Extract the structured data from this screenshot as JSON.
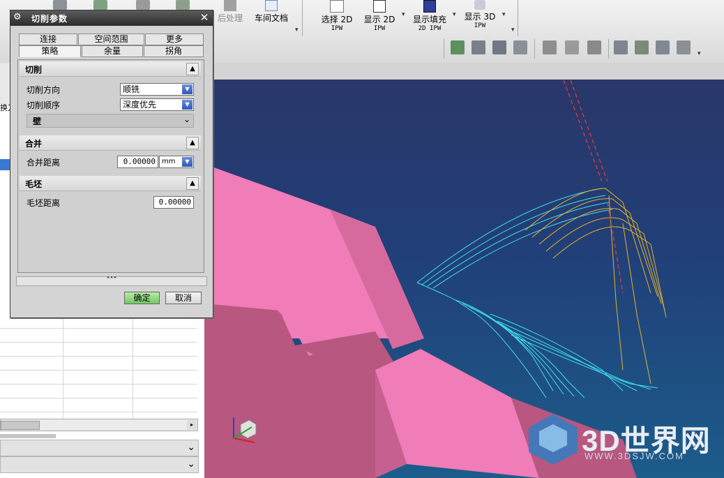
{
  "toolbar": {
    "postprocess_label": "后处理",
    "shop_doc_label": "车间文档",
    "select_2d": {
      "line1": "选择 2D",
      "line2": "IPW"
    },
    "show_2d": {
      "line1": "显示 2D",
      "line2": "IPW"
    },
    "show_fill": {
      "line1": "显示填充",
      "line2": "2D IPW"
    },
    "show_3d": {
      "line1": "显示 3D",
      "line2": "IPW"
    },
    "dropdown_glyph": "▾"
  },
  "left_panel": {
    "column_header": "换刀"
  },
  "dialog": {
    "title": "切削参数",
    "tabs_row1": [
      "连接",
      "空间范围",
      "更多"
    ],
    "tabs_row2": [
      "策略",
      "余量",
      "拐角"
    ],
    "active_tab": "策略",
    "sections": {
      "cutting": {
        "title": "切削",
        "direction_label": "切削方向",
        "direction_value": "顺铣",
        "order_label": "切削顺序",
        "order_value": "深度优先",
        "wall_label": "壁"
      },
      "merge": {
        "title": "合并",
        "distance_label": "合并距离",
        "distance_value": "0.00000",
        "unit_value": "mm"
      },
      "blank": {
        "title": "毛坯",
        "distance_label": "毛坯距离",
        "distance_value": "0.00000"
      }
    },
    "more_glyph": "˄˄˄",
    "ok_label": "确定",
    "cancel_label": "取消"
  },
  "logo": {
    "brand": "3D世界网",
    "url": "WWW.3DSJW.COM"
  },
  "colors": {
    "part_pink": "#f07cb8",
    "part_shade": "#b8577f",
    "toolpath_cyan": "#3fe0f0",
    "toolpath_yellow": "#e8b22b",
    "ok_green": "#8fd37f",
    "combo_blue": "#2c58b9"
  },
  "icons": [
    "gear-icon",
    "close-icon",
    "chevron-up-icon",
    "chevron-down-icon",
    "wcs-triad-icon"
  ]
}
